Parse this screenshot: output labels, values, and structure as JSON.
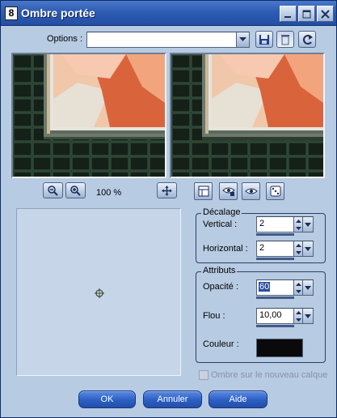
{
  "window": {
    "title": "Ombre portée",
    "app_icon_text": "8"
  },
  "options": {
    "label": "Options :",
    "value": ""
  },
  "zoom": {
    "level": "100 %"
  },
  "decalage": {
    "group_title": "Décalage",
    "vertical_label": "Vertical :",
    "vertical_value": "2",
    "horizontal_label": "Horizontal :",
    "horizontal_value": "2"
  },
  "attributs": {
    "group_title": "Attributs",
    "opacite_label": "Opacité :",
    "opacite_value": "60",
    "flou_label": "Flou :",
    "flou_value": "10,00",
    "couleur_label": "Couleur :",
    "couleur_color": "#0a0a0a"
  },
  "new_layer_checkbox": {
    "label": "Ombre sur le nouveau calque",
    "checked": false,
    "enabled": false
  },
  "buttons": {
    "ok": "OK",
    "cancel": "Annuler",
    "help": "Aide"
  },
  "colors": {
    "dialog_bg": "#b7cbe3",
    "titlebar": "#2e5cb4",
    "button_blue": "#2c5fc4"
  }
}
